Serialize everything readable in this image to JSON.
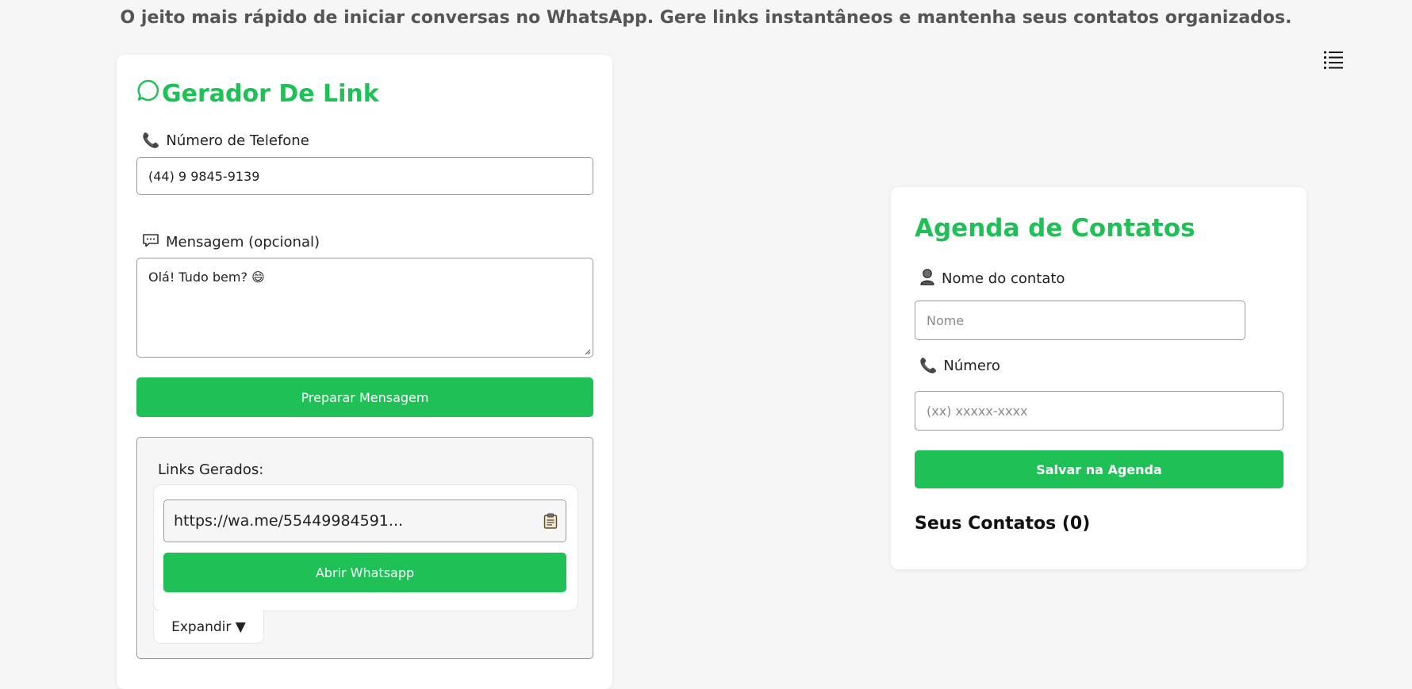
{
  "header": {
    "tagline": "O jeito mais rápido de iniciar conversas no WhatsApp. Gere links instantâneos e mantenha seus contatos organizados."
  },
  "generator": {
    "title": "Gerador De Link",
    "phone_label": "Número de Telefone",
    "phone_value": "(44) 9 9845-9139",
    "message_label": "Mensagem (opcional)",
    "message_value": "Olá! Tudo bem? 😄",
    "prepare_button": "Preparar Mensagem",
    "links_title": "Links Gerados:",
    "generated_link": "https://wa.me/55449984591...",
    "open_button": "Abrir Whatsapp",
    "expand_label": "Expandir ▼"
  },
  "agenda": {
    "title": "Agenda de Contatos",
    "name_label": "Nome do contato",
    "name_placeholder": "Nome",
    "number_label": "Número",
    "number_placeholder": "(xx) xxxxx-xxxx",
    "save_button": "Salvar na Agenda",
    "contacts_title": "Seus Contatos (0)"
  },
  "icons": {
    "phone": "phone-icon",
    "speech": "speech-bubble-icon",
    "person": "person-icon",
    "clipboard": "clipboard-icon",
    "menu": "menu-list-icon",
    "whatsapp": "whatsapp-bubble-icon"
  },
  "colors": {
    "accent": "#1fc157",
    "background": "#f6f6f7"
  }
}
